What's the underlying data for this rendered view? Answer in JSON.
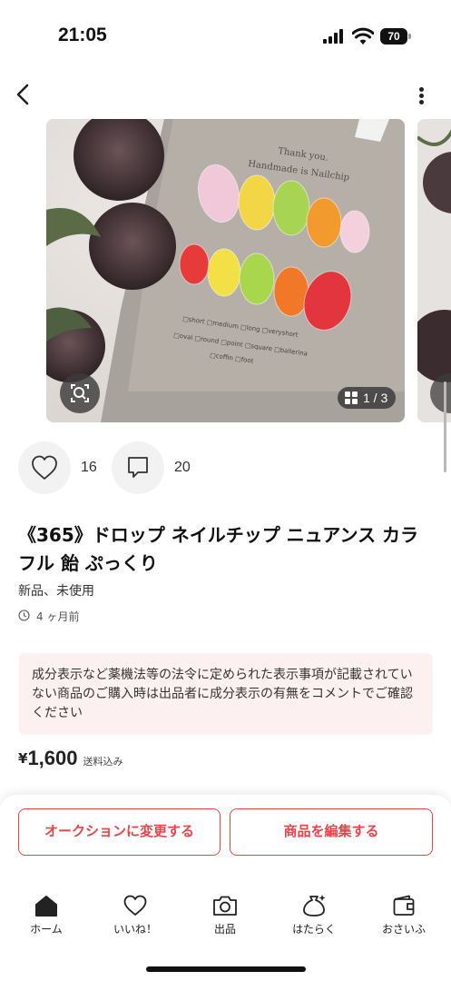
{
  "status_bar": {
    "time": "21:05",
    "battery": "70"
  },
  "gallery": {
    "page_indicator": "1 / 3",
    "card_text": "Thank you.\nHandmade is Nailchip"
  },
  "actions": {
    "likes": "16",
    "comments": "20"
  },
  "product": {
    "title": "《365》ドロップ ネイルチップ ニュアンス カラフル 飴 ぷっくり",
    "condition": "新品、未使用",
    "posted": "4 ヶ月前",
    "notice": "成分表示など薬機法等の法令に定められた表示事項が記載されていない商品のご購入時は出品者に成分表示の有無をコメントでご確認ください",
    "price_symbol": "¥",
    "price": "1,600",
    "shipping": "送料込み"
  },
  "buttons": {
    "auction": "オークションに変更する",
    "edit": "商品を編集する"
  },
  "tabbar": {
    "items": [
      {
        "label": "ホーム",
        "icon": "home-icon"
      },
      {
        "label": "いいね！",
        "icon": "heart-icon"
      },
      {
        "label": "出品",
        "icon": "camera-icon"
      },
      {
        "label": "はたらく",
        "icon": "money-bag-icon"
      },
      {
        "label": "おさいふ",
        "icon": "wallet-icon"
      }
    ]
  },
  "colors": {
    "accent": "#e8444a",
    "notice_bg": "#fdf0f1"
  }
}
